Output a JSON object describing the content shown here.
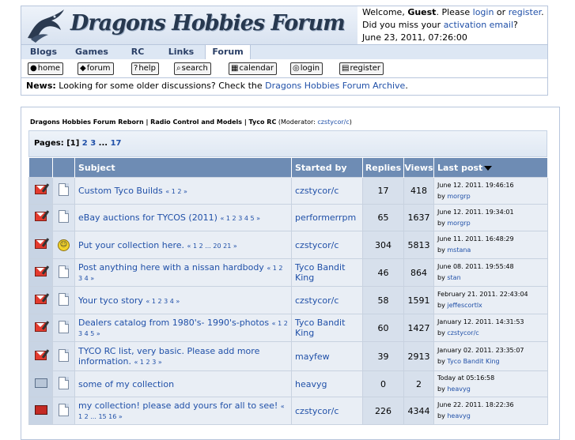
{
  "site": {
    "title": "Dragons Hobbies Forum"
  },
  "welcome": {
    "prefix": "Welcome, ",
    "guest": "Guest",
    "please": ". Please ",
    "login": "login",
    "or": " or ",
    "register": "register",
    "period": ".",
    "missed_prefix": "Did you miss your ",
    "activation": "activation email",
    "missed_suffix": "?",
    "datetime": "June 23, 2011, 07:26:00"
  },
  "topnav": {
    "tabs": [
      "Blogs",
      "Games",
      "RC",
      "Links",
      "Forum"
    ],
    "active": "Forum"
  },
  "iconbar": {
    "buttons": [
      {
        "label": "home",
        "icon": "globe-icon",
        "glyph": "●"
      },
      {
        "label": "forum",
        "icon": "diamond-icon",
        "glyph": "◆"
      },
      {
        "label": "help",
        "icon": "question-icon",
        "glyph": "?"
      },
      {
        "label": "search",
        "icon": "search-icon",
        "glyph": "⌕"
      },
      {
        "label": "calendar",
        "icon": "calendar-icon",
        "glyph": "▦"
      },
      {
        "label": "login",
        "icon": "login-icon",
        "glyph": "◎"
      },
      {
        "label": "register",
        "icon": "register-icon",
        "glyph": "▤"
      }
    ]
  },
  "news": {
    "label": "News:",
    "text": " Looking for some older discussions? Check the ",
    "link": "Dragons Hobbies Forum Archive",
    "suffix": "."
  },
  "breadcrumb": {
    "items": [
      "Dragons Hobbies Forum Reborn",
      "Radio Control and Models",
      "Tyco RC"
    ],
    "separator": " | ",
    "moderator_label": " (Moderator: ",
    "moderator": "czstycor/c",
    "moderator_suffix": ")"
  },
  "pagination": {
    "label": "Pages: ",
    "current": "[1]",
    "pages": [
      "2",
      "3"
    ],
    "ellipsis": " ... ",
    "last": "17"
  },
  "table": {
    "headers": {
      "subject": "Subject",
      "started_by": "Started by",
      "replies": "Replies",
      "views": "Views",
      "last_post": "Last post"
    },
    "rows": [
      {
        "icon1": "hot-topic-icon",
        "icon2": "document-icon",
        "subject": "Custom Tyco Builds",
        "pages": "« 1 2 »",
        "starter": "czstycor/c",
        "replies": "17",
        "views": "418",
        "last_date": "June 12. 2011. 19:46:16",
        "last_by": "morgrp"
      },
      {
        "icon1": "hot-topic-icon",
        "icon2": "document-icon",
        "subject": "eBay auctions for TYCOS (2011)",
        "pages": "« 1 2 3 4 5 »",
        "starter": "performerrpm",
        "replies": "65",
        "views": "1637",
        "last_date": "June 12. 2011. 19:34:01",
        "last_by": "morgrp"
      },
      {
        "icon1": "hot-topic-icon",
        "icon2": "smiley-icon",
        "subject": "Put your collection here.",
        "pages": "« 1 2 ... 20 21 »",
        "starter": "czstycor/c",
        "replies": "304",
        "views": "5813",
        "last_date": "June 11. 2011. 16:48:29",
        "last_by": "mstana"
      },
      {
        "icon1": "hot-topic-icon",
        "icon2": "document-icon",
        "subject": "Post anything here with a nissan hardbody",
        "pages": "« 1 2 3 4 »",
        "starter": "Tyco Bandit King",
        "replies": "46",
        "views": "864",
        "last_date": "June 08. 2011. 19:55:48",
        "last_by": "stan"
      },
      {
        "icon1": "hot-topic-icon",
        "icon2": "document-icon",
        "subject": "Your tyco story",
        "pages": "« 1 2 3 4 »",
        "starter": "czstycor/c",
        "replies": "58",
        "views": "1591",
        "last_date": "February 21. 2011. 22:43:04",
        "last_by": "jeffescortlx"
      },
      {
        "icon1": "hot-topic-icon",
        "icon2": "document-icon",
        "subject": "Dealers catalog from 1980's- 1990's-photos",
        "pages": "« 1 2 3 4 5 »",
        "starter": "Tyco Bandit King",
        "replies": "60",
        "views": "1427",
        "last_date": "January 12. 2011. 14:31:53",
        "last_by": "czstycor/c"
      },
      {
        "icon1": "hot-topic-icon",
        "icon2": "document-icon",
        "subject": "TYCO RC list, very basic. Please add more information.",
        "pages": "« 1 2 3 »",
        "starter": "mayfew",
        "replies": "39",
        "views": "2913",
        "last_date": "January 02. 2011. 23:35:07",
        "last_by": "Tyco Bandit King"
      },
      {
        "icon1": "folder-icon",
        "icon2": "document-icon",
        "subject": "some of my collection",
        "pages": "",
        "starter": "heavyg",
        "replies": "0",
        "views": "2",
        "last_date": "Today at 05:16:58",
        "last_by": "heavyg"
      },
      {
        "icon1": "very-hot-topic-icon",
        "icon2": "document-icon",
        "subject": "my collection! please add yours for all to see!",
        "pages": "« 1 2 ... 15 16 »",
        "starter": "czstycor/c",
        "replies": "226",
        "views": "4344",
        "last_date": "June 22. 2011. 18:22:36",
        "last_by": "heavyg"
      }
    ],
    "by_label": "by "
  },
  "colors": {
    "header_bg": "#6e8cb4",
    "link": "#2050a8",
    "accent": "#27384f"
  }
}
